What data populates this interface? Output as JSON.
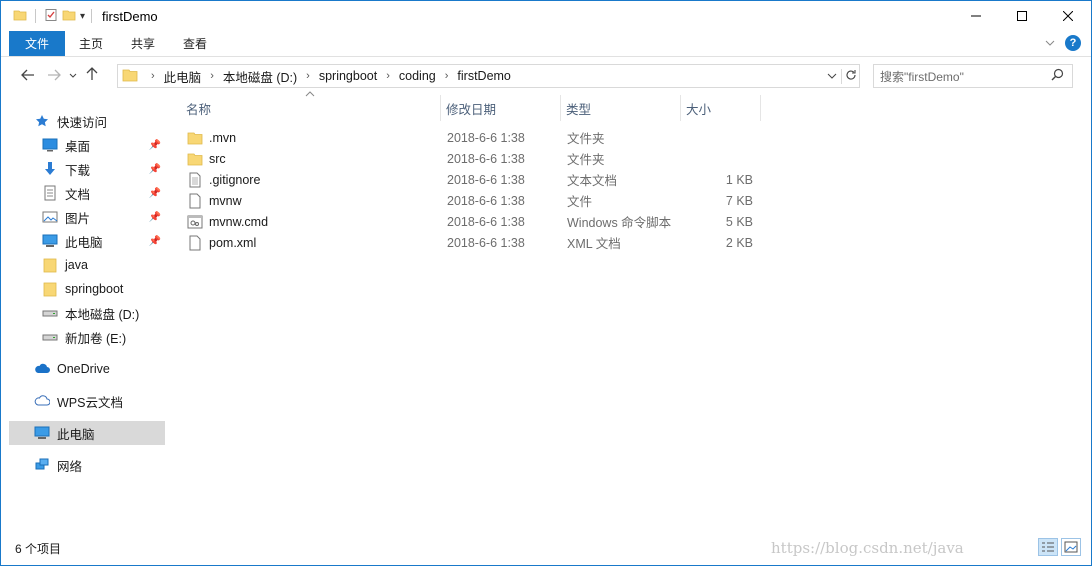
{
  "window": {
    "title": "firstDemo"
  },
  "ribbon": {
    "tabs": [
      "文件",
      "主页",
      "共享",
      "查看"
    ]
  },
  "address": {
    "crumbs": [
      "此电脑",
      "本地磁盘 (D:)",
      "springboot",
      "coding",
      "firstDemo"
    ]
  },
  "search": {
    "placeholder": "搜索\"firstDemo\""
  },
  "sidebar": {
    "items": [
      {
        "label": "快速访问",
        "icon": "star-icon"
      },
      {
        "label": "桌面",
        "icon": "desktop-icon",
        "pinned": true
      },
      {
        "label": "下载",
        "icon": "download-icon",
        "pinned": true
      },
      {
        "label": "文档",
        "icon": "document-icon",
        "pinned": true
      },
      {
        "label": "图片",
        "icon": "picture-icon",
        "pinned": true
      },
      {
        "label": "此电脑",
        "icon": "computer-icon",
        "pinned": true
      },
      {
        "label": "java",
        "icon": "folder-icon"
      },
      {
        "label": "springboot",
        "icon": "folder-icon"
      },
      {
        "label": "本地磁盘 (D:)",
        "icon": "drive-icon"
      },
      {
        "label": "新加卷 (E:)",
        "icon": "drive-icon"
      },
      {
        "label": "OneDrive",
        "icon": "cloud-icon"
      },
      {
        "label": "WPS云文档",
        "icon": "cloud-outline-icon"
      },
      {
        "label": "此电脑",
        "icon": "computer-icon"
      },
      {
        "label": "网络",
        "icon": "network-icon"
      }
    ]
  },
  "columns": {
    "name": "名称",
    "date": "修改日期",
    "type": "类型",
    "size": "大小"
  },
  "files": [
    {
      "name": ".mvn",
      "date": "2018-6-6 1:38",
      "type": "文件夹",
      "size": "",
      "icon": "folder-icon"
    },
    {
      "name": "src",
      "date": "2018-6-6 1:38",
      "type": "文件夹",
      "size": "",
      "icon": "folder-icon"
    },
    {
      "name": ".gitignore",
      "date": "2018-6-6 1:38",
      "type": "文本文档",
      "size": "1 KB",
      "icon": "text-file-icon"
    },
    {
      "name": "mvnw",
      "date": "2018-6-6 1:38",
      "type": "文件",
      "size": "7 KB",
      "icon": "file-icon"
    },
    {
      "name": "mvnw.cmd",
      "date": "2018-6-6 1:38",
      "type": "Windows 命令脚本",
      "size": "5 KB",
      "icon": "script-file-icon"
    },
    {
      "name": "pom.xml",
      "date": "2018-6-6 1:38",
      "type": "XML 文档",
      "size": "2 KB",
      "icon": "file-icon"
    }
  ],
  "status": {
    "count": "6 个项目"
  },
  "watermark": "https://blog.csdn.net/java"
}
